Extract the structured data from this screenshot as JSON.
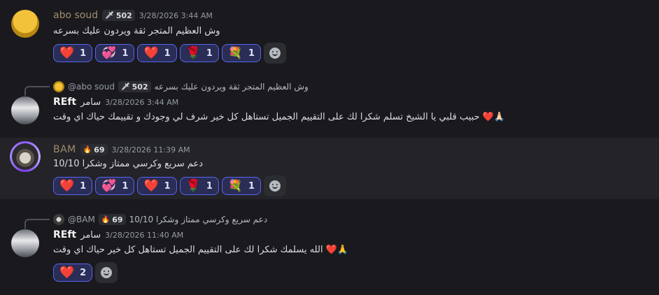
{
  "messages": [
    {
      "author": "abo soud",
      "tag": "502",
      "time": "3/28/2026 3:44 AM",
      "text": "وش العظيم المتجر ثقة ويردون عليك بسرعه",
      "reactions": [
        {
          "emoji": "❤️",
          "count": "1"
        },
        {
          "emoji": "💞",
          "count": "1"
        },
        {
          "emoji": "❤️",
          "count": "1"
        },
        {
          "emoji": "🌹",
          "count": "1"
        },
        {
          "emoji": "💐",
          "count": "1"
        }
      ]
    },
    {
      "reply": {
        "author": "@abo soud",
        "tag": "502",
        "text": "وش العظيم المتجر ثقة ويردون عليك بسرعه"
      },
      "author": "REft",
      "author_ar": "سامر",
      "time": "3/28/2026 3:44 AM",
      "text": "حبيب قلبي يا الشيخ تسلم شكرا لك على التقييم الجميل تستاهل كل خير شرف لي وجودك و تقييمك حياك اي وقت ❤️🙏🏻"
    },
    {
      "author": "BAM",
      "tag": "69",
      "time": "3/28/2026 11:39 AM",
      "text": "دعم سريع وكرسي ممتاز وشكرا 10/10",
      "reactions": [
        {
          "emoji": "❤️",
          "count": "1"
        },
        {
          "emoji": "💞",
          "count": "1"
        },
        {
          "emoji": "❤️",
          "count": "1"
        },
        {
          "emoji": "🌹",
          "count": "1"
        },
        {
          "emoji": "💐",
          "count": "1"
        }
      ]
    },
    {
      "reply": {
        "author": "@BAM",
        "tag": "69",
        "text": "دعم سريع وكرسي ممتاز وشكرا 10/10"
      },
      "author": "REft",
      "author_ar": "سامر",
      "time": "3/28/2026 11:40 AM",
      "text": "الله يسلمك شكرا لك على التقييم الجميل تستاهل كل خير حياك اي وقت ❤️🙏",
      "reactions": [
        {
          "emoji": "❤️",
          "count": "2"
        }
      ]
    }
  ],
  "colors": {
    "accent": "#5865f2",
    "reaction_bg": "#2a2d56",
    "background": "#1a1a1e",
    "highlight": "#232328"
  }
}
